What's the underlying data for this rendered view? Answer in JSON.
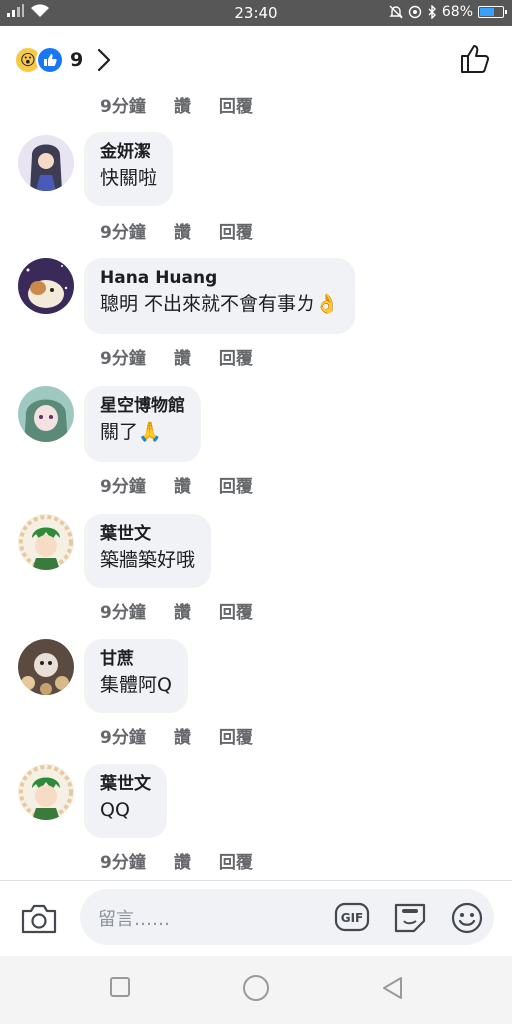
{
  "status": {
    "time": "23:40",
    "battery": "68%",
    "battery_level": 0.68
  },
  "header": {
    "reactions": [
      "wow",
      "like"
    ],
    "reaction_count": "9"
  },
  "first_meta": {
    "time": "9分鐘",
    "like": "讚",
    "reply": "回覆"
  },
  "comments": [
    {
      "name": "金妍潔",
      "text": "快關啦",
      "time": "9分鐘",
      "like": "讚",
      "reply": "回覆"
    },
    {
      "name": "Hana Huang",
      "text": "聰明  不出來就不會有事ㄌ",
      "emoji": "👌",
      "time": "9分鐘",
      "like": "讚",
      "reply": "回覆"
    },
    {
      "name": "星空博物館",
      "text": "關了",
      "emoji": "🙏",
      "time": "9分鐘",
      "like": "讚",
      "reply": "回覆"
    },
    {
      "name": "葉世文",
      "text": "築牆築好哦",
      "time": "9分鐘",
      "like": "讚",
      "reply": "回覆"
    },
    {
      "name": "甘蔗",
      "text": "集體阿Q",
      "time": "9分鐘",
      "like": "讚",
      "reply": "回覆"
    },
    {
      "name": "葉世文",
      "text": "QQ",
      "time": "9分鐘",
      "like": "讚",
      "reply": "回覆"
    }
  ],
  "composer": {
    "placeholder": "留言……"
  },
  "colors": {
    "accent": "#1877f2",
    "bubble": "#f0f2f5",
    "meta": "#65676b"
  }
}
